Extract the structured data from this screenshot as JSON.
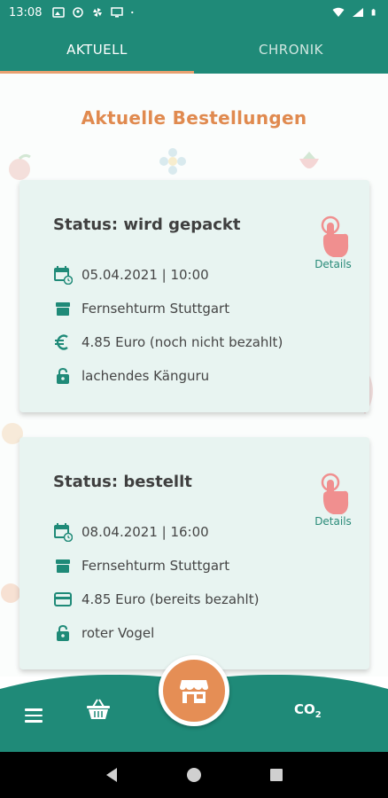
{
  "status_bar": {
    "time": "13:08",
    "icons_left": [
      "image-icon",
      "account-icon",
      "pinwheel-icon",
      "monitor-icon",
      "dot-icon"
    ],
    "icons_right": [
      "wifi-icon",
      "signal-icon",
      "battery-icon"
    ]
  },
  "tabs": [
    {
      "label": "AKTUELL",
      "active": true
    },
    {
      "label": "CHRONIK",
      "active": false
    }
  ],
  "page_title": "Aktuelle Bestellungen",
  "orders": [
    {
      "status": "Status: wird gepackt",
      "datetime": "05.04.2021 |  10:00",
      "location": "Fernsehturm Stuttgart",
      "price": "4.85 Euro (noch nicht bezahlt)",
      "payment_icon": "euro-icon",
      "code": "lachendes Känguru",
      "details_label": "Details"
    },
    {
      "status": "Status: bestellt",
      "datetime": "08.04.2021 |  16:00",
      "location": "Fernsehturm Stuttgart",
      "price": "4.85 Euro (bereits bezahlt)",
      "payment_icon": "credit-card-icon",
      "code": "roter Vogel",
      "details_label": "Details"
    }
  ],
  "bottom_nav": {
    "co2_label": "CO",
    "co2_sub": "2",
    "items": [
      "menu-icon",
      "basket-icon",
      "shop-icon",
      "co2-icon"
    ]
  },
  "colors": {
    "primary": "#1f8a78",
    "accent": "#e58e55",
    "card_bg": "#e8f4f1",
    "title": "#e08a4f"
  }
}
